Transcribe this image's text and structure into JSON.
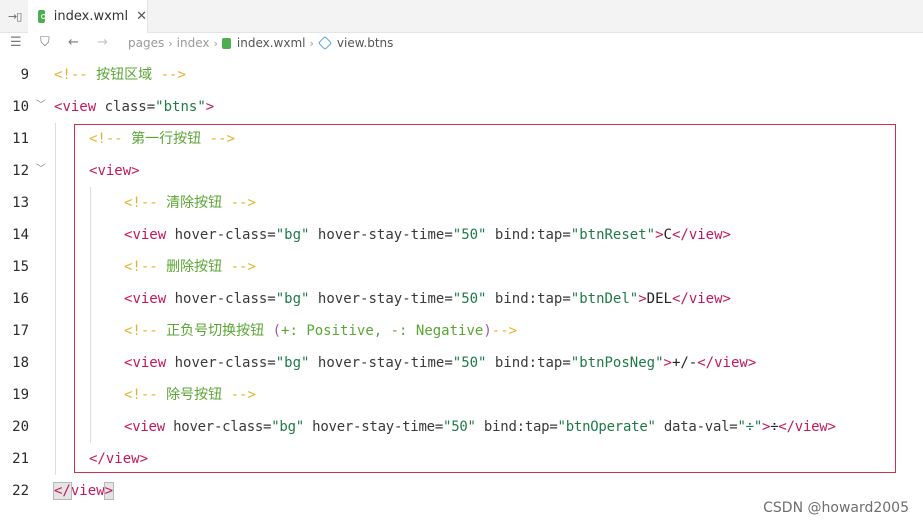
{
  "tabbar": {
    "toggle_glyph": "→▯",
    "tab": {
      "icon": "wxml-file-icon",
      "label": "index.wxml",
      "close_glyph": "✕"
    }
  },
  "breadcrumb": {
    "list_glyph": "☰",
    "bookmark_glyph": "⛉",
    "back_glyph": "←",
    "forward_glyph": "→",
    "items": [
      "pages",
      "index",
      "index.wxml",
      "view.btns"
    ],
    "separator": "›"
  },
  "editor": {
    "lines": [
      {
        "n": "9"
      },
      {
        "n": "10"
      },
      {
        "n": "11"
      },
      {
        "n": "12"
      },
      {
        "n": "13"
      },
      {
        "n": "14"
      },
      {
        "n": "15"
      },
      {
        "n": "16"
      },
      {
        "n": "17"
      },
      {
        "n": "18"
      },
      {
        "n": "19"
      },
      {
        "n": "20"
      },
      {
        "n": "21"
      },
      {
        "n": "22"
      }
    ],
    "tokens": {
      "comment_open": "<!--",
      "comment_close": "-->",
      "c9": "按钮区域",
      "c11": "第一行按钮",
      "c13": "清除按钮",
      "c15": "删除按钮",
      "c17": "正负号切换按钮",
      "c17_paren_open": "(",
      "c17_paren_body": "+: Positive, -: Negative",
      "c17_paren_close": ")",
      "c19": "除号按钮",
      "view": "view",
      "lt": "<",
      "gt": ">",
      "lt_slash": "</",
      "attr_class": "class=",
      "val_btns": "\"btns\"",
      "attr_hover": "hover-class=",
      "val_bg": "\"bg\"",
      "attr_stay": "hover-stay-time=",
      "val_50": "\"50\"",
      "attr_tap": "bind:tap=",
      "val_reset": "\"btnReset\"",
      "val_del": "\"btnDel\"",
      "val_posneg": "\"btnPosNeg\"",
      "val_operate": "\"btnOperate\"",
      "attr_dataval": "data-val=",
      "val_div": "\"÷\"",
      "txt_c": "C",
      "txt_del": "DEL",
      "txt_posneg": "+/-",
      "txt_div": "÷"
    }
  },
  "watermark": "CSDN @howard2005",
  "colors": {
    "tag": "#c2185b",
    "comment_delim": "#e5b32b",
    "comment_text": "#5ba534",
    "string": "#1f7a48",
    "highlight_border": "#d0314a"
  }
}
